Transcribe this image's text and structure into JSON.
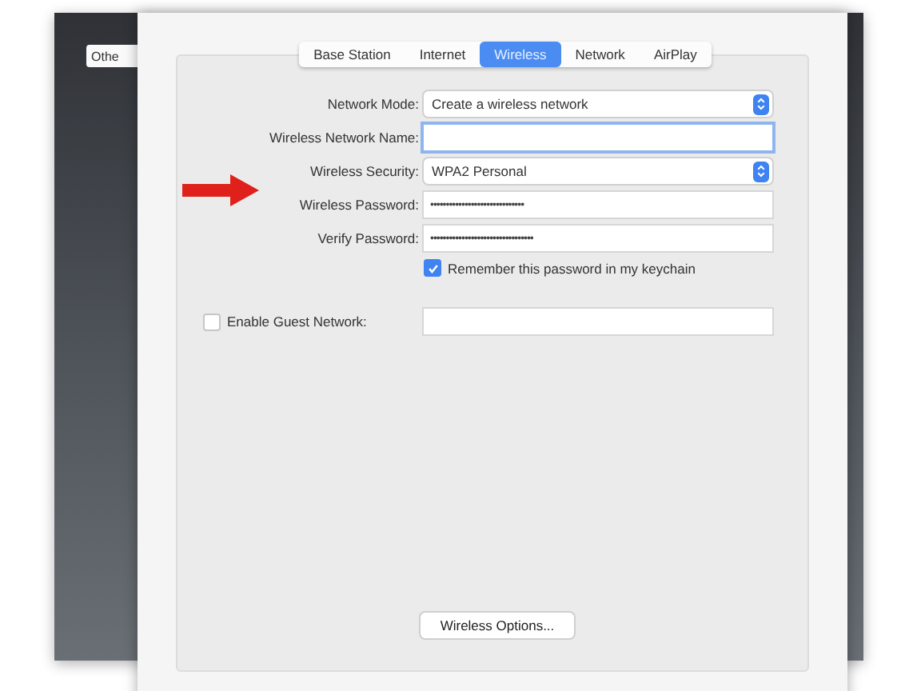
{
  "background_window": {
    "button": "Othe"
  },
  "tabs": [
    {
      "label": "Base Station",
      "selected": false
    },
    {
      "label": "Internet",
      "selected": false
    },
    {
      "label": "Wireless",
      "selected": true
    },
    {
      "label": "Network",
      "selected": false
    },
    {
      "label": "AirPlay",
      "selected": false
    }
  ],
  "form": [
    {
      "kind": "select",
      "label": "Network Mode:",
      "value": "Create a wireless network"
    },
    {
      "kind": "text",
      "label": "Wireless Network Name:",
      "focused": true
    },
    {
      "kind": "select",
      "label": "Wireless Security:",
      "value": "WPA2 Personal"
    },
    {
      "kind": "text",
      "label": "Wireless Password:",
      "value": "••••••••••••••••••••••••••••••",
      "focused": false
    },
    {
      "kind": "text",
      "label": "Verify Password:",
      "value": "•••••••••••••••••••••••••••••••••",
      "focused": false
    },
    {
      "kind": "checkbox",
      "label": "Remember this password in my keychain",
      "checked": true
    }
  ],
  "guest_network": {
    "label": "Enable Guest Network:",
    "checked": false
  },
  "options_button": "Wireless Options..."
}
